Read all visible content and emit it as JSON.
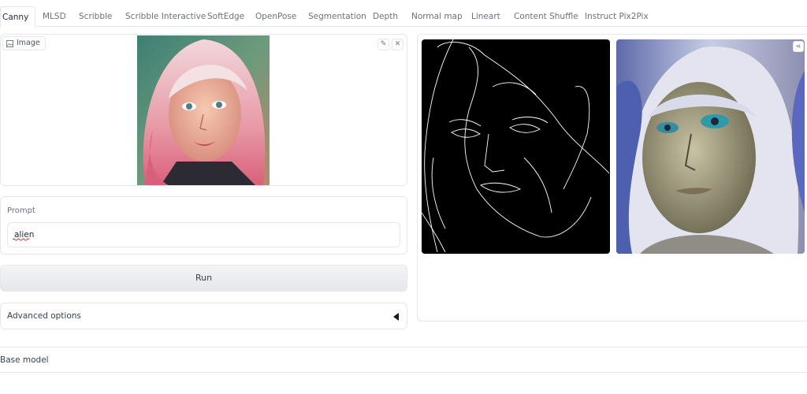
{
  "tabs": [
    {
      "label": "Canny",
      "active": true
    },
    {
      "label": "MLSD"
    },
    {
      "label": "Scribble"
    },
    {
      "label": "Scribble Interactive"
    },
    {
      "label": "SoftEdge"
    },
    {
      "label": "OpenPose"
    },
    {
      "label": "Segmentation"
    },
    {
      "label": "Depth"
    },
    {
      "label": "Normal map"
    },
    {
      "label": "Lineart"
    },
    {
      "label": "Content Shuffle"
    },
    {
      "label": "Instruct Pix2Pix"
    }
  ],
  "image_input": {
    "label": "Image",
    "edit_icon": "pencil-icon",
    "clear_icon": "close-icon"
  },
  "prompt": {
    "label": "Prompt",
    "value": "alien"
  },
  "run_button": {
    "label": "Run"
  },
  "advanced": {
    "label": "Advanced options",
    "icon": "caret-left-icon"
  },
  "base_model": {
    "label": "Base model"
  },
  "colors": {
    "accent": "#e5e7eb",
    "run_bg": "#eceef1"
  }
}
